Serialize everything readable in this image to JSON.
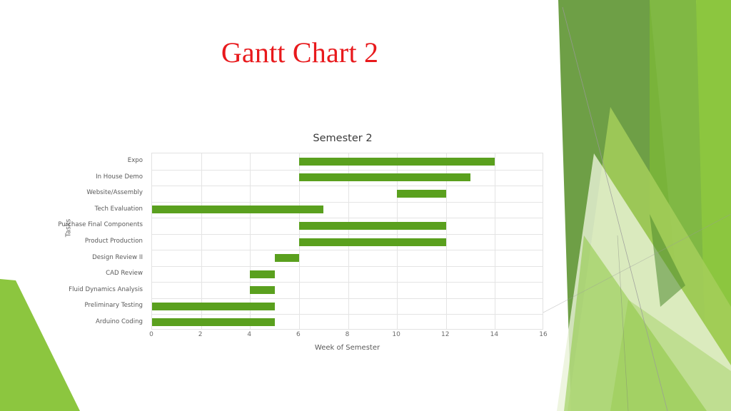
{
  "slide": {
    "title": "Gantt Chart 2",
    "title_color": "#E8191C",
    "background": "#FFFFFF"
  },
  "theme": {
    "name": "facet-green-decoration",
    "colors": {
      "dark_olive": "#6E9F46",
      "mid_green": "#79B43A",
      "bright_green": "#8CC63F",
      "light_green": "#A5CE5B",
      "pale_green": "#D9E9BC",
      "very_pale_green": "#EAF3D8",
      "line_gray": "#9A9A9A"
    }
  },
  "chart_data": {
    "type": "bar",
    "orientation": "horizontal",
    "subtype": "gantt",
    "title": "Semester 2",
    "xlabel": "Week of Semester",
    "ylabel": "Tasks",
    "xlim": [
      0,
      16
    ],
    "xticks": [
      0,
      2,
      4,
      6,
      8,
      10,
      12,
      14,
      16
    ],
    "grid": true,
    "bar_color": "#5AA01E",
    "categories": [
      "Expo",
      "In House Demo",
      "Website/Assembly",
      "Tech Evaluation",
      "Purchase Final Components",
      "Product Production",
      "Design Review II",
      "CAD Review",
      "Fluid Dynamics Analysis",
      "Preliminary Testing",
      "Arduino Coding"
    ],
    "tasks": [
      {
        "name": "Expo",
        "start": 6,
        "end": 14,
        "duration": 8
      },
      {
        "name": "In House Demo",
        "start": 6,
        "end": 13,
        "duration": 7
      },
      {
        "name": "Website/Assembly",
        "start": 10,
        "end": 12,
        "duration": 2
      },
      {
        "name": "Tech Evaluation",
        "start": 0,
        "end": 7,
        "duration": 7
      },
      {
        "name": "Purchase Final Components",
        "start": 6,
        "end": 12,
        "duration": 6
      },
      {
        "name": "Product Production",
        "start": 6,
        "end": 12,
        "duration": 6
      },
      {
        "name": "Design Review II",
        "start": 5,
        "end": 6,
        "duration": 1
      },
      {
        "name": "CAD Review",
        "start": 4,
        "end": 5,
        "duration": 1
      },
      {
        "name": "Fluid Dynamics Analysis",
        "start": 4,
        "end": 5,
        "duration": 1
      },
      {
        "name": "Preliminary Testing",
        "start": 0,
        "end": 5,
        "duration": 5
      },
      {
        "name": "Arduino Coding",
        "start": 0,
        "end": 5,
        "duration": 5
      }
    ]
  }
}
